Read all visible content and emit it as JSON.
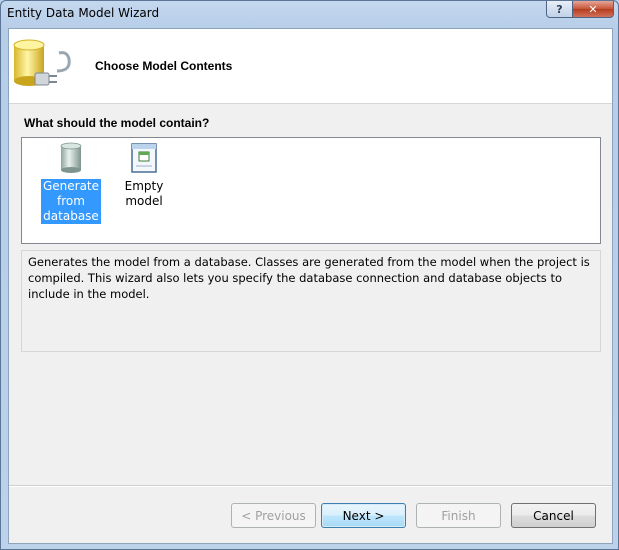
{
  "window": {
    "title": "Entity Data Model Wizard",
    "help_label": "?",
    "close_label": "✕"
  },
  "header": {
    "title": "Choose Model Contents"
  },
  "question": "What should the model contain?",
  "templates": [
    {
      "label_lines": [
        "Generate",
        "from",
        "database"
      ],
      "selected": true,
      "icon": "database-icon"
    },
    {
      "label_lines": [
        "Empty model"
      ],
      "selected": false,
      "icon": "empty-model-icon"
    }
  ],
  "description": "Generates the model from a database. Classes are generated from the model when the project is compiled. This wizard also lets you specify the database connection and database objects to include in the model.",
  "buttons": {
    "previous": "< Previous",
    "next": "Next >",
    "finish": "Finish",
    "cancel": "Cancel"
  },
  "colors": {
    "selection": "#3399ff",
    "header_bg": "#ffffff",
    "client_bg": "#f0f0f0"
  }
}
